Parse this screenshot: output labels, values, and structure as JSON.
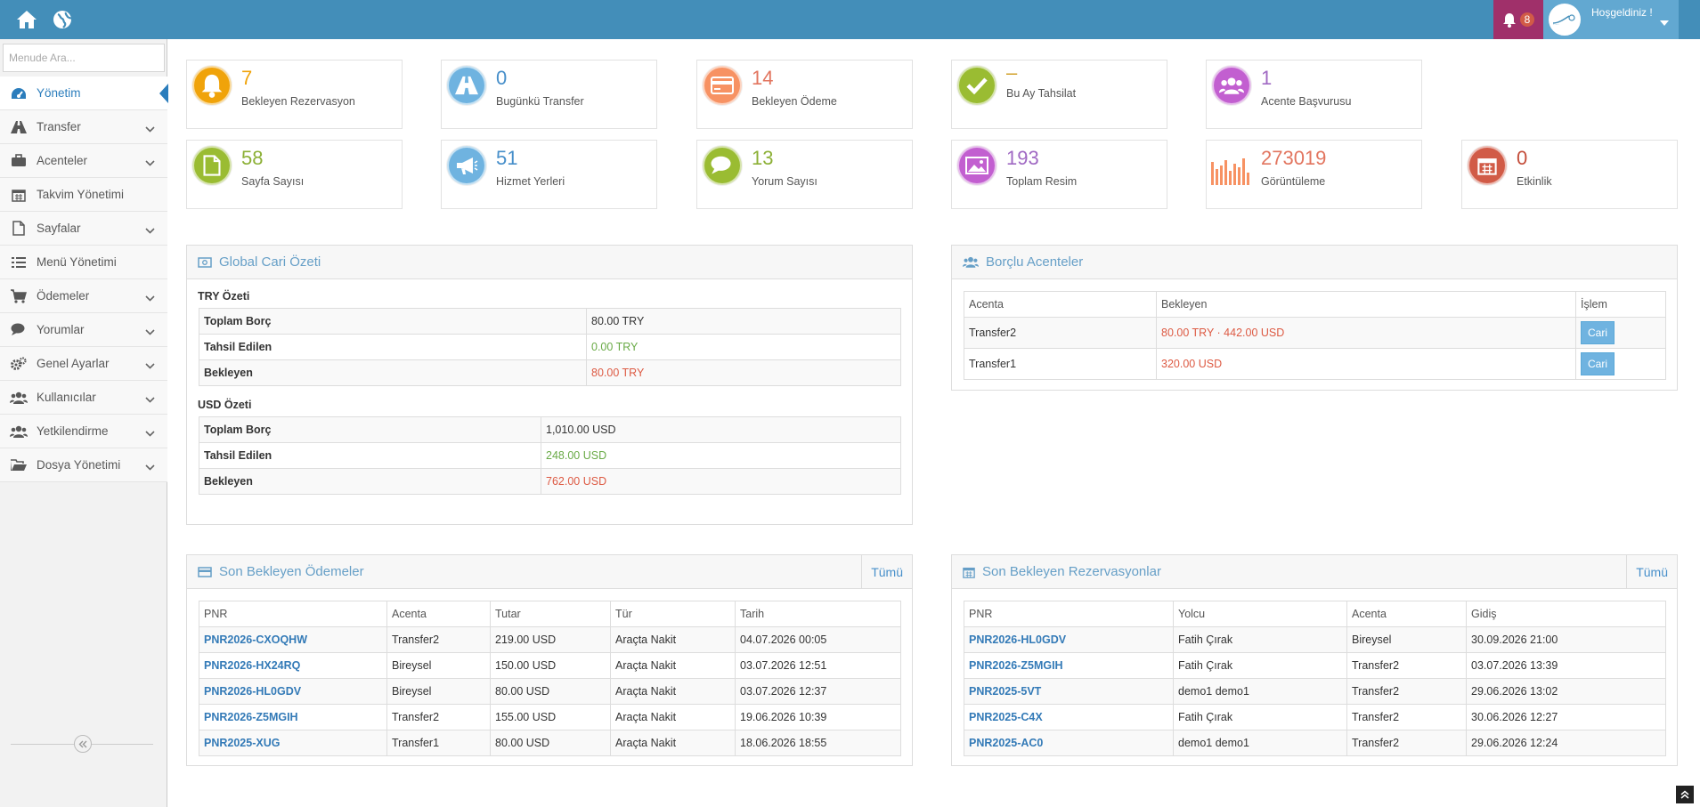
{
  "topbar": {
    "home_icon": "home-icon",
    "globe_icon": "globe-icon",
    "notification_count": "8",
    "welcome_text": "Hoşgeldiniz !",
    "colors": {
      "bar": "#438eb9",
      "notif_bg": "#a0306a",
      "user_bg": "#62a8d1"
    }
  },
  "sidebar": {
    "search_placeholder": "Menude Ara...",
    "items": [
      {
        "label": "Yönetim",
        "icon": "dashboard-icon"
      },
      {
        "label": "Transfer",
        "icon": "road-icon"
      },
      {
        "label": "Acenteler",
        "icon": "briefcase-icon"
      },
      {
        "label": "Takvim Yönetimi",
        "icon": "calendar-icon"
      },
      {
        "label": "Sayfalar",
        "icon": "file-icon"
      },
      {
        "label": "Menü Yönetimi",
        "icon": "list-icon"
      },
      {
        "label": "Ödemeler",
        "icon": "cart-icon"
      },
      {
        "label": "Yorumlar",
        "icon": "comments-icon"
      },
      {
        "label": "Genel Ayarlar",
        "icon": "cogs-icon"
      },
      {
        "label": "Kullanıcılar",
        "icon": "users-icon"
      },
      {
        "label": "Yetkilendirme",
        "icon": "users-icon"
      },
      {
        "label": "Dosya Yönetimi",
        "icon": "folder-open-icon"
      }
    ]
  },
  "stats": [
    {
      "value": "7",
      "label": "Bekleyen Rezervasyon",
      "icon": "bell-icon",
      "color": "#f0a30a"
    },
    {
      "value": "0",
      "label": "Bugünkü Transfer",
      "icon": "road-icon",
      "color": "#6fb3e0"
    },
    {
      "value": "14",
      "label": "Bekleyen Ödeme",
      "icon": "credit-card-icon",
      "color": "#f79263"
    },
    {
      "value": "–",
      "label": "Bu Ay Tahsilat",
      "icon": "check-icon",
      "color": "#9abc32"
    },
    {
      "value": "1",
      "label": "Acente Başvurusu",
      "icon": "users-icon",
      "color": "#c25fd0"
    },
    {
      "value": "58",
      "label": "Sayfa Sayısı",
      "icon": "file-icon",
      "color": "#9abc32"
    },
    {
      "value": "51",
      "label": "Hizmet Yerleri",
      "icon": "bullhorn-icon",
      "color": "#6fb3e0"
    },
    {
      "value": "13",
      "label": "Yorum Sayısı",
      "icon": "comments-icon",
      "color": "#9abc32"
    },
    {
      "value": "193",
      "label": "Toplam Resim",
      "icon": "picture-icon",
      "color": "#c25fd0"
    },
    {
      "value": "273019",
      "label": "Görüntüleme",
      "icon": "bar-chart-icon",
      "color": "#f79263"
    },
    {
      "value": "0",
      "label": "Etkinlik",
      "icon": "calendar-icon",
      "color": "#d15b47"
    }
  ],
  "global_cari": {
    "title": "Global Cari Özeti",
    "try": {
      "title": "TRY Özeti",
      "rows": [
        {
          "label": "Toplam Borç",
          "value": "80.00 TRY"
        },
        {
          "label": "Tahsil Edilen",
          "value": "0.00 TRY"
        },
        {
          "label": "Bekleyen",
          "value": "80.00 TRY"
        }
      ]
    },
    "usd": {
      "title": "USD Özeti",
      "rows": [
        {
          "label": "Toplam Borç",
          "value": "1,010.00 USD"
        },
        {
          "label": "Tahsil Edilen",
          "value": "248.00 USD"
        },
        {
          "label": "Bekleyen",
          "value": "762.00 USD"
        }
      ]
    }
  },
  "borclu": {
    "title": "Borçlu Acenteler",
    "headers": [
      "Acenta",
      "Bekleyen",
      "İşlem"
    ],
    "rows": [
      {
        "acenta": "Transfer2",
        "bekleyen": "80.00 TRY · 442.00 USD",
        "action": "Cari"
      },
      {
        "acenta": "Transfer1",
        "bekleyen": "320.00 USD",
        "action": "Cari"
      }
    ]
  },
  "odemeler": {
    "title": "Son Bekleyen Ödemeler",
    "link": "Tümü",
    "headers": [
      "PNR",
      "Acenta",
      "Tutar",
      "Tür",
      "Tarih"
    ],
    "rows": [
      [
        "PNR2026-CXOQHW",
        "Transfer2",
        "219.00 USD",
        "Araçta Nakit",
        "04.07.2026 00:05"
      ],
      [
        "PNR2026-HX24RQ",
        "Bireysel",
        "150.00 USD",
        "Araçta Nakit",
        "03.07.2026 12:51"
      ],
      [
        "PNR2026-HL0GDV",
        "Bireysel",
        "80.00 USD",
        "Araçta Nakit",
        "03.07.2026 12:37"
      ],
      [
        "PNR2026-Z5MGIH",
        "Transfer2",
        "155.00 USD",
        "Araçta Nakit",
        "19.06.2026 10:39"
      ],
      [
        "PNR2025-XUG",
        "Transfer1",
        "80.00 USD",
        "Araçta Nakit",
        "18.06.2026 18:55"
      ]
    ]
  },
  "rezervasyonlar": {
    "title": "Son Bekleyen Rezervasyonlar",
    "link": "Tümü",
    "headers": [
      "PNR",
      "Yolcu",
      "Acenta",
      "Gidiş"
    ],
    "rows": [
      [
        "PNR2026-HL0GDV",
        "Fatih Çırak",
        "Bireysel",
        "30.09.2026 21:00"
      ],
      [
        "PNR2026-Z5MGIH",
        "Fatih Çırak",
        "Transfer2",
        "03.07.2026 13:39"
      ],
      [
        "PNR2025-5VT",
        "demo1 demo1",
        "Transfer2",
        "29.06.2026 13:02"
      ],
      [
        "PNR2025-C4X",
        "Fatih Çırak",
        "Transfer2",
        "30.06.2026 12:27"
      ],
      [
        "PNR2025-AC0",
        "demo1 demo1",
        "Transfer2",
        "29.06.2026 12:24"
      ]
    ]
  }
}
